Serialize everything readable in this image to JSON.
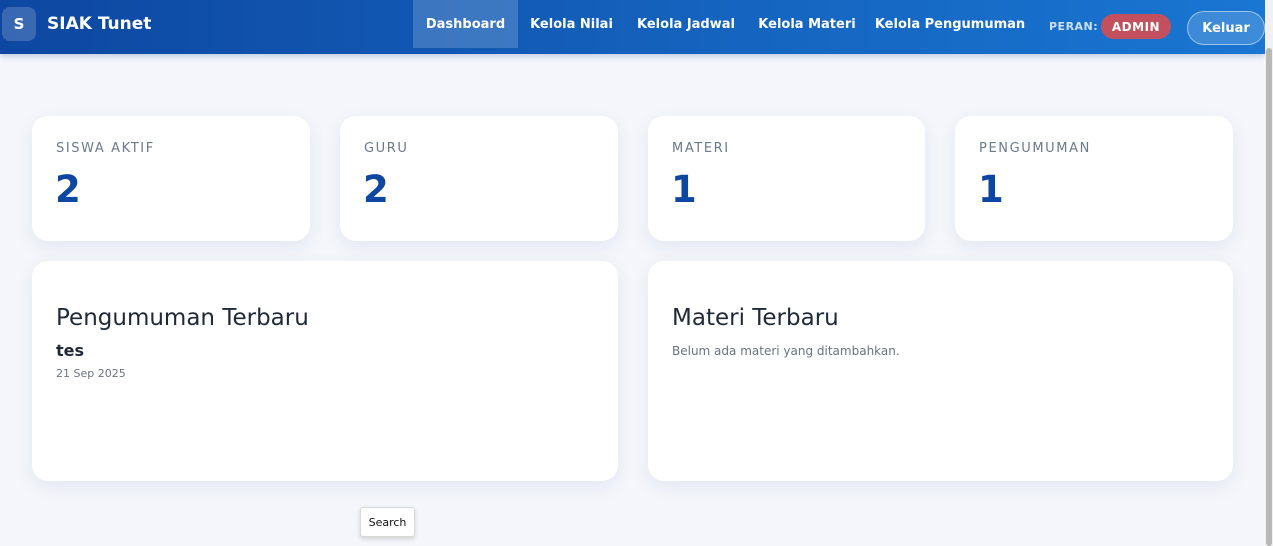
{
  "brand": {
    "logo_letter": "S",
    "name": "SIAK Tunet"
  },
  "nav": {
    "items": [
      {
        "label": "Dashboard",
        "active": true
      },
      {
        "label": "Kelola Nilai"
      },
      {
        "label": "Kelola Jadwal"
      },
      {
        "label": "Kelola Materi"
      },
      {
        "label": "Kelola Pengumuman"
      }
    ],
    "role_label": "PERAN:",
    "role_value": "ADMIN",
    "logout_label": "Keluar"
  },
  "stats": [
    {
      "label": "SISWA AKTIF",
      "value": "2"
    },
    {
      "label": "GURU",
      "value": "2"
    },
    {
      "label": "MATERI",
      "value": "1"
    },
    {
      "label": "PENGUMUMAN",
      "value": "1"
    }
  ],
  "announcements": {
    "title": "Pengumuman Terbaru",
    "latest_title": "tes",
    "latest_date": "21 Sep 2025"
  },
  "materials": {
    "title": "Materi Terbaru",
    "empty_text": "Belum ada materi yang ditambahkan."
  },
  "tooltip": {
    "label": "Search"
  },
  "colors": {
    "primary": "#0d47a1",
    "accent": "#1976d2",
    "badge": "#c2505e",
    "background": "#f4f6fb"
  }
}
